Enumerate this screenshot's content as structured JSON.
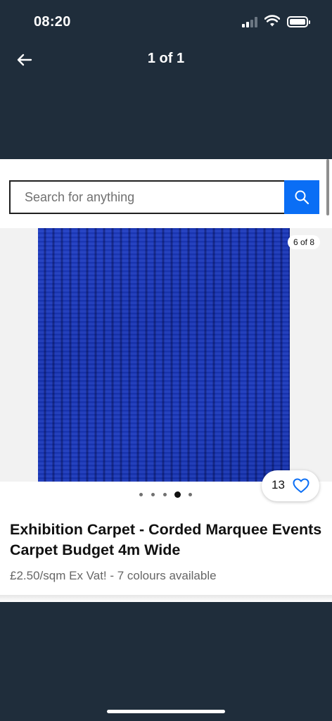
{
  "status_bar": {
    "time": "08:20"
  },
  "header": {
    "title": "1 of 1",
    "back_icon": "arrow-left-icon"
  },
  "search": {
    "placeholder": "Search for anything",
    "icon": "search-icon"
  },
  "gallery": {
    "counter": "6 of 8",
    "dot_count": 5,
    "active_dot": 4
  },
  "watch": {
    "count": "13",
    "icon": "heart-outline-icon"
  },
  "listing": {
    "title": "Exhibition Carpet - Corded Marquee Events Carpet Budget 4m Wide",
    "subtitle": "£2.50/sqm Ex Vat! - 7 colours available"
  },
  "colors": {
    "header_bg": "#1f2d3b",
    "accent": "#0a6ef5",
    "carpet": "#1a38bd"
  }
}
